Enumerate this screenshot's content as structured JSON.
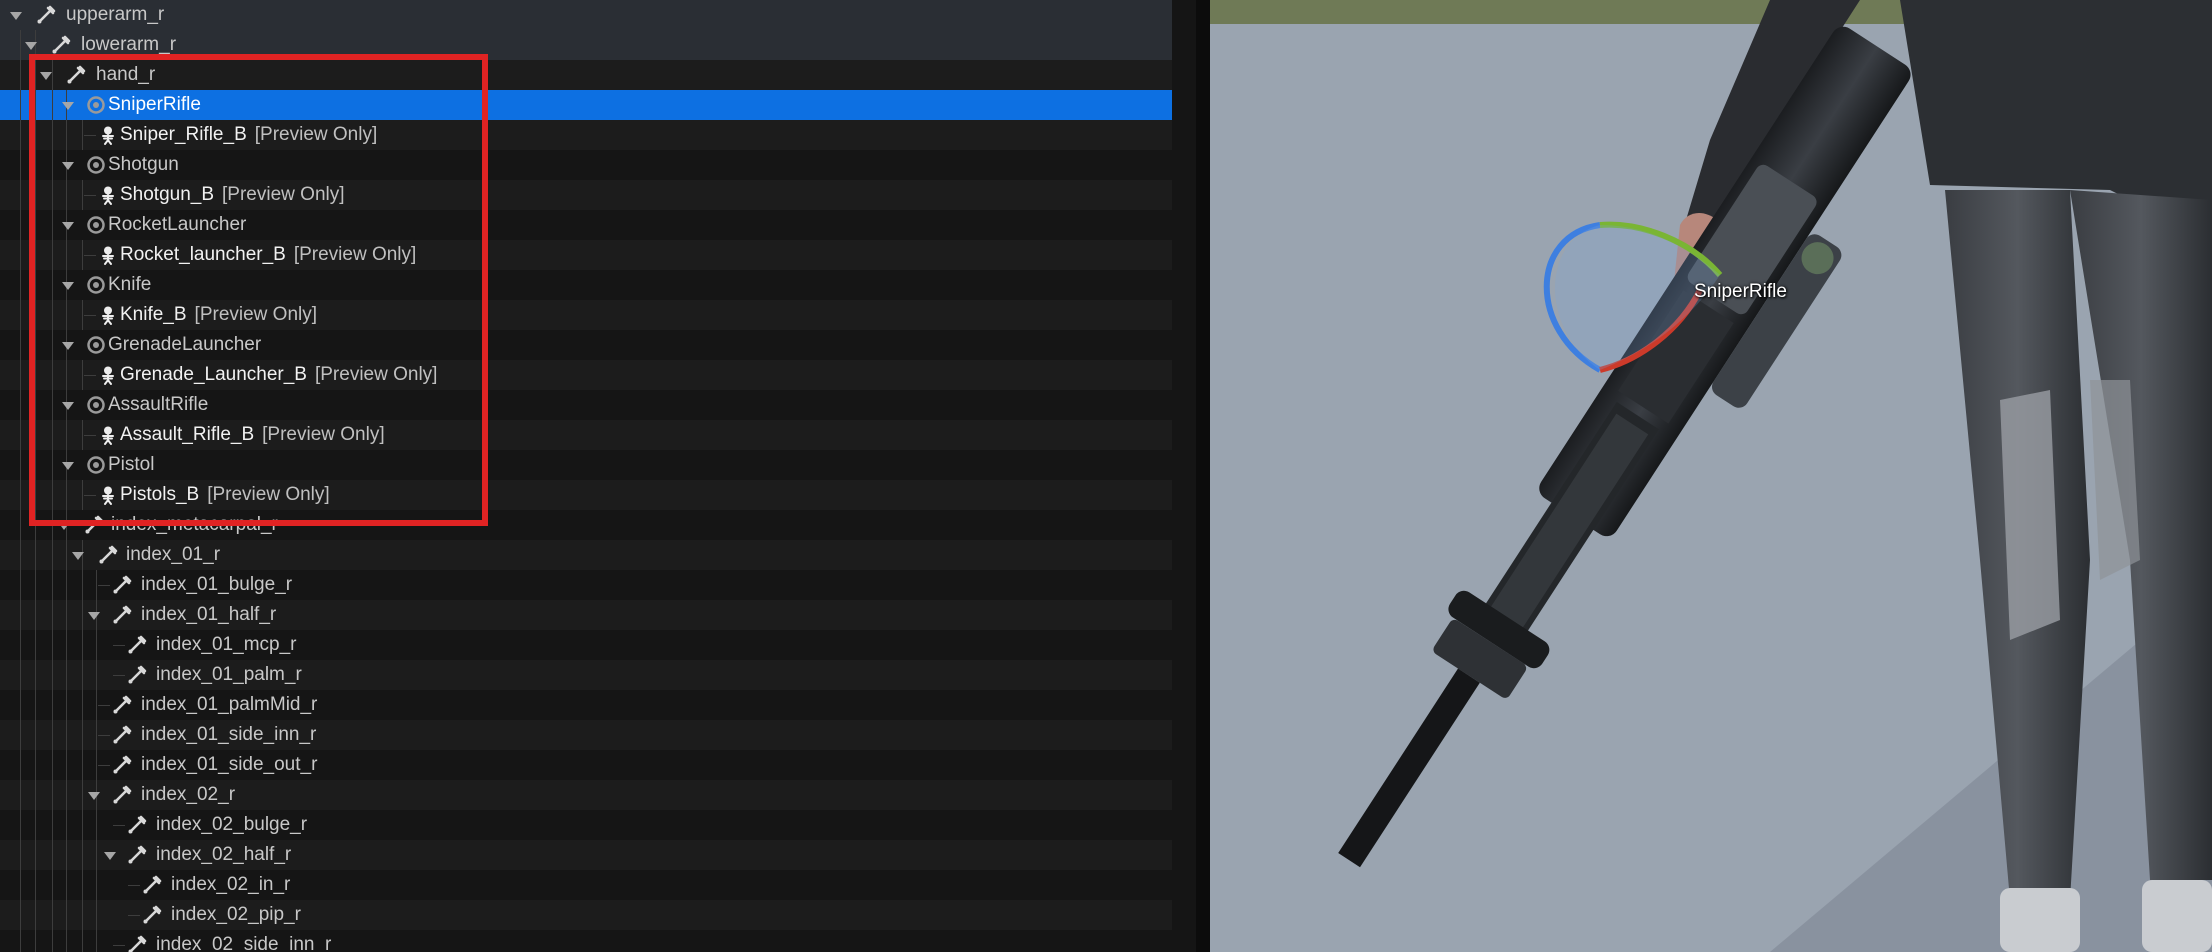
{
  "tree": {
    "rows": [
      {
        "label": "upperarm_r",
        "icon": "bone-icon",
        "kind": "bone"
      },
      {
        "label": "lowerarm_r",
        "icon": "bone-icon",
        "kind": "bone"
      },
      {
        "label": "hand_r",
        "icon": "bone-icon",
        "kind": "bone"
      },
      {
        "label": "SniperRifle",
        "icon": "socket-icon",
        "kind": "socket"
      },
      {
        "label": "Sniper_Rifle_B",
        "suffix": "[Preview Only]",
        "icon": "skeletal-mesh-icon",
        "kind": "mesh"
      },
      {
        "label": "Shotgun",
        "icon": "socket-icon",
        "kind": "socket"
      },
      {
        "label": "Shotgun_B",
        "suffix": "[Preview Only]",
        "icon": "skeletal-mesh-icon",
        "kind": "mesh"
      },
      {
        "label": "RocketLauncher",
        "icon": "socket-icon",
        "kind": "socket"
      },
      {
        "label": "Rocket_launcher_B",
        "suffix": "[Preview Only]",
        "icon": "skeletal-mesh-icon",
        "kind": "mesh"
      },
      {
        "label": "Knife",
        "icon": "socket-icon",
        "kind": "socket"
      },
      {
        "label": "Knife_B",
        "suffix": "[Preview Only]",
        "icon": "skeletal-mesh-icon",
        "kind": "mesh"
      },
      {
        "label": "GrenadeLauncher",
        "icon": "socket-icon",
        "kind": "socket"
      },
      {
        "label": "Grenade_Launcher_B",
        "suffix": "[Preview Only]",
        "icon": "skeletal-mesh-icon",
        "kind": "mesh"
      },
      {
        "label": "AssaultRifle",
        "icon": "socket-icon",
        "kind": "socket"
      },
      {
        "label": "Assault_Rifle_B",
        "suffix": "[Preview Only]",
        "icon": "skeletal-mesh-icon",
        "kind": "mesh"
      },
      {
        "label": "Pistol",
        "icon": "socket-icon",
        "kind": "socket"
      },
      {
        "label": "Pistols_B",
        "suffix": "[Preview Only]",
        "icon": "skeletal-mesh-icon",
        "kind": "mesh"
      },
      {
        "label": "index_metacarpal_r",
        "icon": "bone-icon",
        "kind": "bone"
      },
      {
        "label": "index_01_r",
        "icon": "bone-icon",
        "kind": "bone"
      },
      {
        "label": "index_01_bulge_r",
        "icon": "bone-icon",
        "kind": "bone"
      },
      {
        "label": "index_01_half_r",
        "icon": "bone-icon",
        "kind": "bone"
      },
      {
        "label": "index_01_mcp_r",
        "icon": "bone-icon",
        "kind": "bone"
      },
      {
        "label": "index_01_palm_r",
        "icon": "bone-icon",
        "kind": "bone"
      },
      {
        "label": "index_01_palmMid_r",
        "icon": "bone-icon",
        "kind": "bone"
      },
      {
        "label": "index_01_side_inn_r",
        "icon": "bone-icon",
        "kind": "bone"
      },
      {
        "label": "index_01_side_out_r",
        "icon": "bone-icon",
        "kind": "bone"
      },
      {
        "label": "index_02_r",
        "icon": "bone-icon",
        "kind": "bone"
      },
      {
        "label": "index_02_bulge_r",
        "icon": "bone-icon",
        "kind": "bone"
      },
      {
        "label": "index_02_half_r",
        "icon": "bone-icon",
        "kind": "bone"
      },
      {
        "label": "index_02_in_r",
        "icon": "bone-icon",
        "kind": "bone"
      },
      {
        "label": "index_02_pip_r",
        "icon": "bone-icon",
        "kind": "bone"
      },
      {
        "label": "index_02_side_inn_r",
        "icon": "bone-icon",
        "kind": "bone"
      }
    ]
  },
  "viewport": {
    "socket_label": "SniperRifle"
  },
  "colors": {
    "selection": "#0d70e2",
    "highlight_box": "#e02323"
  }
}
